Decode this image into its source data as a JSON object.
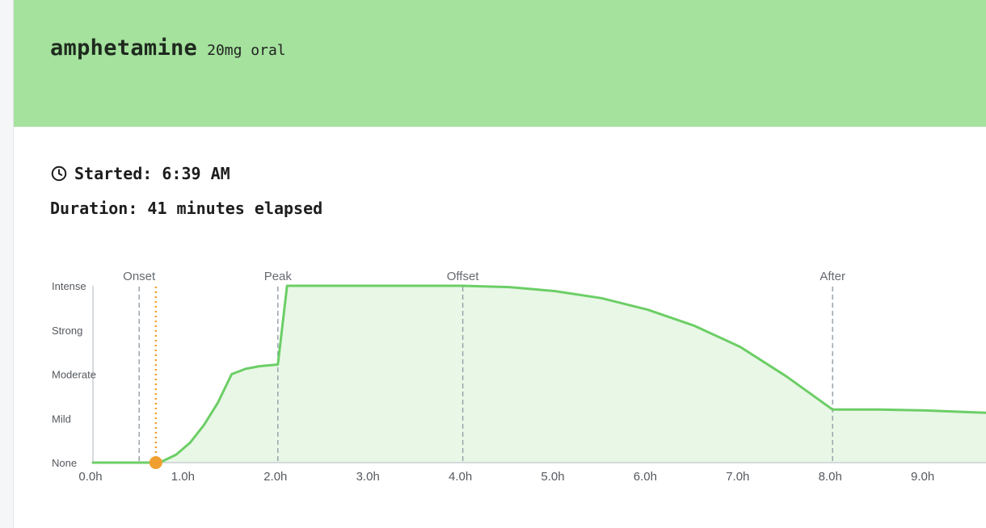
{
  "header": {
    "substance": "amphetamine",
    "dose": "20mg oral",
    "color": "#a4e29d"
  },
  "session": {
    "started_label": "Started: 6:39 AM",
    "duration_label": "Duration: 41 minutes elapsed",
    "clock_icon": "clock-icon"
  },
  "chart_data": {
    "type": "area",
    "x_unit": "hours",
    "xlim": [
      0,
      10
    ],
    "x_ticks": [
      0,
      1,
      2,
      3,
      4,
      5,
      6,
      7,
      8,
      9
    ],
    "x_tick_labels": [
      "0.0h",
      "1.0h",
      "2.0h",
      "3.0h",
      "4.0h",
      "5.0h",
      "6.0h",
      "7.0h",
      "8.0h",
      "9.0h"
    ],
    "y_levels": [
      "None",
      "Mild",
      "Moderate",
      "Strong",
      "Intense"
    ],
    "ylim": [
      0,
      4
    ],
    "series": [
      {
        "color": "#6cce66",
        "x": [
          0,
          0.68,
          0.75,
          0.9,
          1.05,
          1.2,
          1.35,
          1.5,
          1.65,
          1.8,
          2.0,
          2.1,
          2.5,
          3.0,
          3.5,
          4.0,
          4.5,
          5.0,
          5.5,
          6.0,
          6.5,
          7.0,
          7.5,
          8.0,
          8.5,
          9.0,
          9.5,
          10.0
        ],
        "y": [
          0,
          0,
          0.03,
          0.18,
          0.45,
          0.85,
          1.35,
          2.0,
          2.12,
          2.18,
          2.22,
          4.0,
          4.0,
          4.0,
          4.0,
          4.0,
          3.97,
          3.88,
          3.72,
          3.46,
          3.1,
          2.62,
          1.95,
          1.2,
          1.2,
          1.18,
          1.14,
          1.1
        ]
      }
    ],
    "phase_markers": [
      {
        "label": "Onset",
        "x": 0.5
      },
      {
        "label": "Peak",
        "x": 2.0
      },
      {
        "label": "Offset",
        "x": 4.0
      },
      {
        "label": "After",
        "x": 8.0
      }
    ],
    "current_time": {
      "x": 0.68,
      "y": 0,
      "color": "#f0a030"
    },
    "fill_color": "#e8f7e6",
    "marker_line_color": "#9aa3ad"
  }
}
